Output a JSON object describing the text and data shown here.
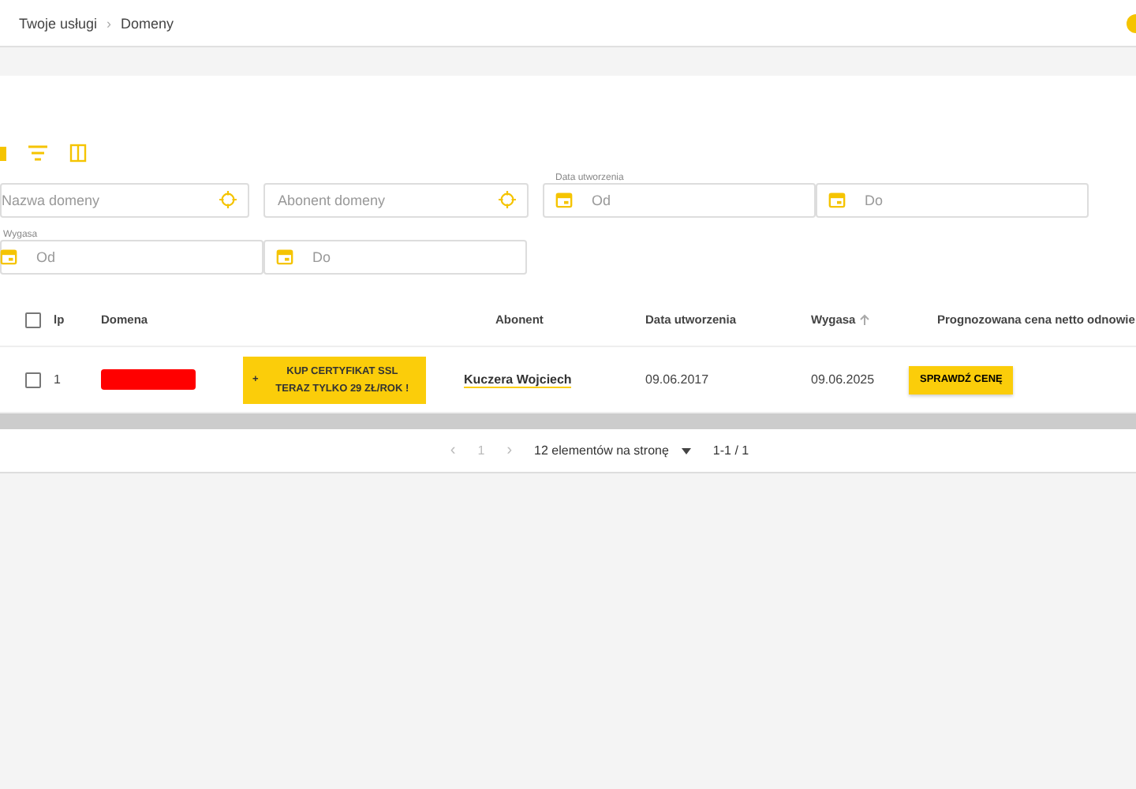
{
  "breadcrumb": [
    "Twoje usługi",
    "Domeny"
  ],
  "breadcrumb_separator": "›",
  "filters": {
    "domain_name": {
      "placeholder": "Nazwa domeny"
    },
    "subscriber": {
      "placeholder": "Abonent domeny"
    },
    "created": {
      "label": "Data utworzenia",
      "from": {
        "placeholder": "Od"
      },
      "to": {
        "placeholder": "Do"
      }
    },
    "expires": {
      "label": "Wygasa",
      "from": {
        "placeholder": "Od"
      },
      "to": {
        "placeholder": "Do"
      }
    }
  },
  "table": {
    "columns": [
      "lp",
      "Domena",
      "",
      "Abonent",
      "Data utworzenia",
      "Wygasa",
      "Prognozowana cena netto odnowie"
    ],
    "header_checked": false,
    "rows": [
      {
        "checked": false,
        "lp": "1",
        "promo_line1": "KUP CERTYFIKAT SSL",
        "promo_line2": "TERAZ TYLKO 29 ZŁ/ROK !",
        "promo_icon": "+",
        "subscriber": "Kuczera Wojciech",
        "created": "09.06.2017",
        "expires": "09.06.2025",
        "action": "SPRAWDŹ CENĘ"
      }
    ]
  },
  "pagination": {
    "prev": "‹",
    "page": "1",
    "next": "›",
    "per_page": "12 elementów na stronę",
    "range": "1-1 / 1"
  }
}
